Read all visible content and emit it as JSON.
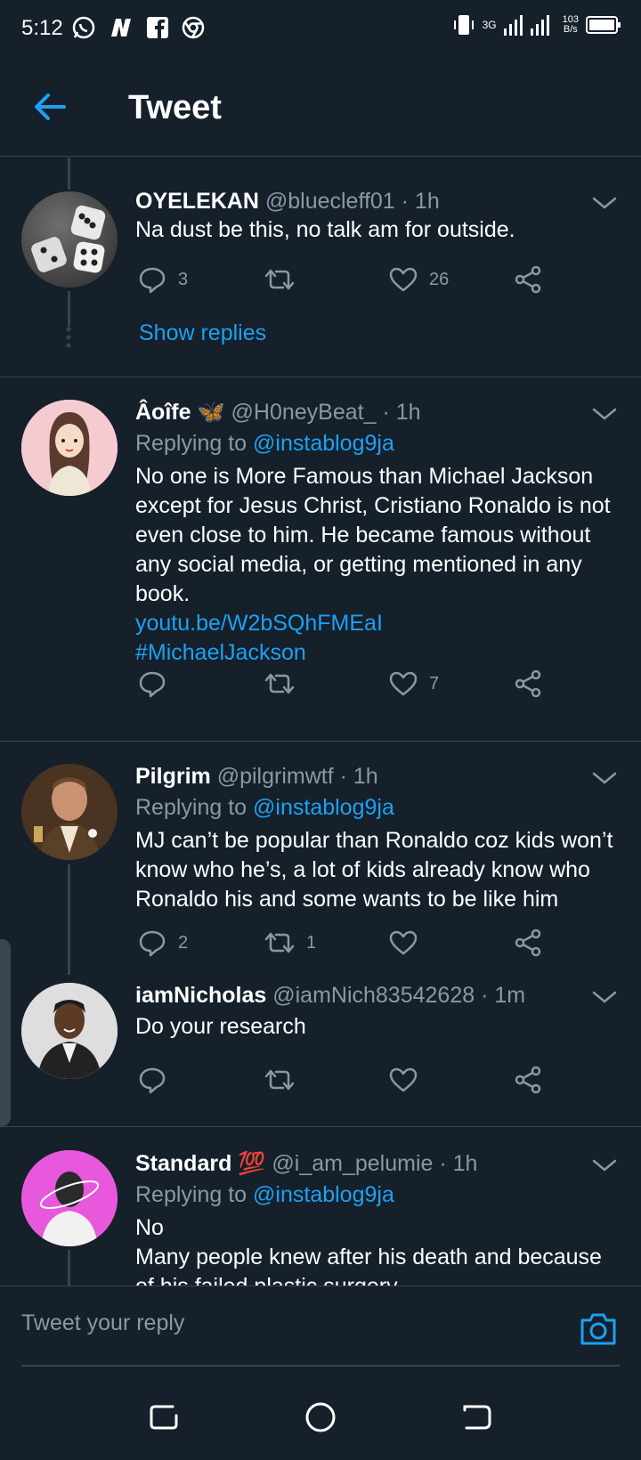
{
  "status_bar": {
    "time": "5:12",
    "network": "3G",
    "speed_value": "103",
    "speed_unit": "B/s"
  },
  "header": {
    "title": "Tweet"
  },
  "tweets": [
    {
      "name": "OYELEKAN",
      "handle": "@bluecleff01 · 1h",
      "text": "Na dust be this, no talk am for outside.",
      "replies": "3",
      "retweets": "",
      "likes": "26",
      "show_replies": "Show replies"
    },
    {
      "name": "Âoîfe 🦋",
      "handle": "@H0neyBeat_ · 1h",
      "replying_prefix": "Replying to",
      "replying_to": "@instablog9ja",
      "text": "No one is More Famous than Michael Jackson except for Jesus Christ, Cristiano Ronaldo is not even close to him. He became famous without any social media, or getting mentioned in any book.",
      "link": "youtu.be/W2bSQhFMEaI",
      "hashtag": "#MichaelJackson",
      "replies": "",
      "retweets": "",
      "likes": "7"
    },
    {
      "name": "Pilgrim",
      "handle": "@pilgrimwtf · 1h",
      "replying_prefix": "Replying to",
      "replying_to": "@instablog9ja",
      "text": "MJ can’t be popular than Ronaldo coz kids won’t know who he’s, a lot of kids already know who Ronaldo his and some wants to be like him",
      "replies": "2",
      "retweets": "1",
      "likes": ""
    },
    {
      "name": "iamNicholas",
      "handle": "@iamNich83542628 · 1m",
      "text": "Do your research",
      "replies": "",
      "retweets": "",
      "likes": ""
    },
    {
      "name": "Standard 💯",
      "handle": "@i_am_pelumie · 1h",
      "replying_prefix": "Replying to",
      "replying_to": "@instablog9ja",
      "text_line1": "No",
      "text_line2": "Many people knew after his death and because",
      "text_line3": "of his failed plastic surgery",
      "replies": "",
      "retweets": "",
      "likes": ""
    }
  ],
  "composer": {
    "placeholder": "Tweet your reply"
  },
  "colors": {
    "background": "#15202b",
    "divider": "#38444d",
    "accent": "#1da1f2",
    "secondary_text": "#8899a6"
  },
  "icons": [
    "back-arrow-icon",
    "chevron-down-icon",
    "reply-icon",
    "retweet-icon",
    "like-icon",
    "share-icon",
    "camera-icon",
    "recents-icon",
    "home-icon",
    "back-icon"
  ]
}
